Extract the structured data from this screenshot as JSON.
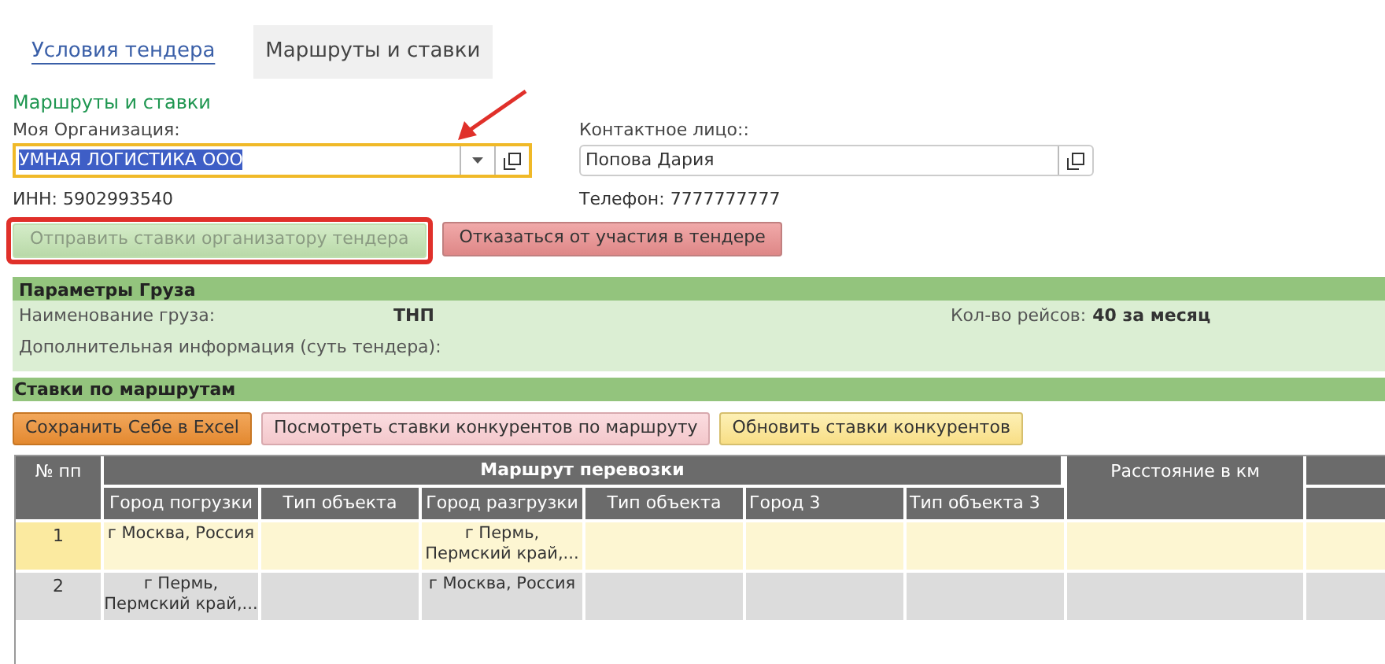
{
  "tabs": [
    {
      "label": "Условия тендера",
      "selected": false
    },
    {
      "label": "Маршруты и ставки",
      "selected": true
    }
  ],
  "section_title": "Маршруты и ставки",
  "organization": {
    "label": "Моя Организация:",
    "value": "УМНАЯ ЛОГИСТИКА ООО",
    "inn": "ИНН: 5902993540"
  },
  "contact": {
    "label": "Контактное лицо::",
    "value": "Попова Дария",
    "phone": "Телефон: 7777777777"
  },
  "actions": [
    {
      "label": "Отправить ставки организатору тендера",
      "kind": "send",
      "disabled": true
    },
    {
      "label": "Отказаться от участия в тендере",
      "kind": "decline",
      "disabled": false
    }
  ],
  "cargo": {
    "title": "Параметры Груза",
    "name_label": "Наименование груза:",
    "name_value": "ТНП",
    "trips_label": "Кол-во рейсов:",
    "trips_value": "40 за месяц",
    "info_label": "Дополнительная информация (суть тендера):"
  },
  "rates": {
    "title": "Ставки по маршрутам",
    "buttons": [
      {
        "label": "Сохранить Себе в Excel",
        "kind": "orange"
      },
      {
        "label": "Посмотреть ставки конкурентов по маршруту",
        "kind": "pink"
      },
      {
        "label": "Обновить ставки конкурентов",
        "kind": "yellow"
      }
    ]
  },
  "table": {
    "number_column": "№ пп",
    "group_column": "Маршрут перевозки",
    "distance_column": "Расстояние в км",
    "columns": [
      "Город погрузки",
      "Тип объекта",
      "Город разгрузки",
      "Тип объекта",
      "Город 3",
      "Тип объекта 3"
    ],
    "rows": [
      {
        "number": "1",
        "selected": true,
        "cells": [
          "г Москва, Россия",
          "",
          "г Пермь, Пермский край,...",
          "",
          "",
          ""
        ]
      },
      {
        "number": "2",
        "selected": false,
        "cells": [
          "г Пермь, Пермский край,...",
          "",
          "г Москва, Россия",
          "",
          "",
          ""
        ]
      }
    ]
  }
}
